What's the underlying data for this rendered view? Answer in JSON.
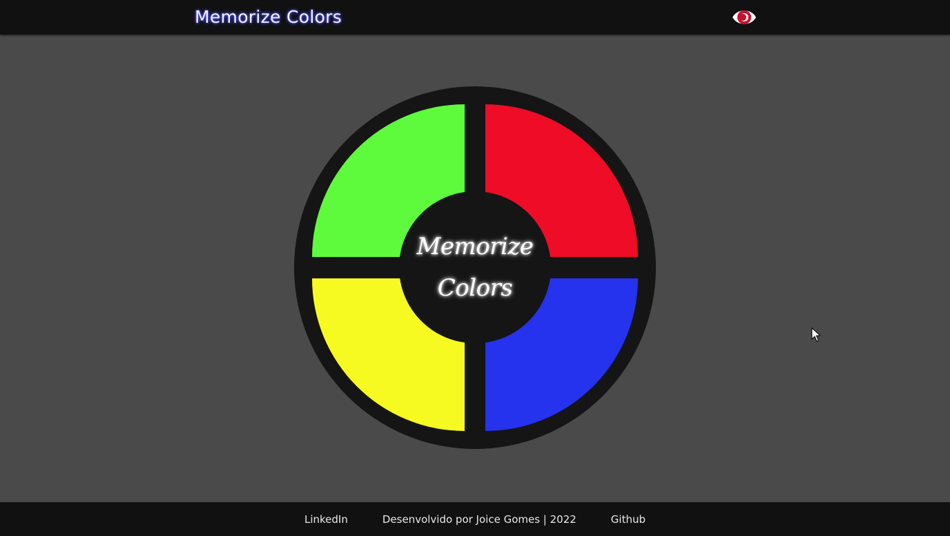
{
  "header": {
    "title": "Memorize Colors",
    "toggle_icon": "eye-icon"
  },
  "game": {
    "center_line_1": "Memorize",
    "center_line_2": "Colors",
    "pads": [
      {
        "name": "green",
        "color": "#5efb3d"
      },
      {
        "name": "red",
        "color": "#ee0c26"
      },
      {
        "name": "yellow",
        "color": "#f7fa20"
      },
      {
        "name": "blue",
        "color": "#2532ee"
      }
    ]
  },
  "footer": {
    "linkedin_label": "LinkedIn",
    "credit": "Desenvolvido por Joice Gomes | 2022",
    "github_label": "Github"
  },
  "colors": {
    "background": "#4a4a4a",
    "bar": "#111111",
    "board": "#151515"
  }
}
